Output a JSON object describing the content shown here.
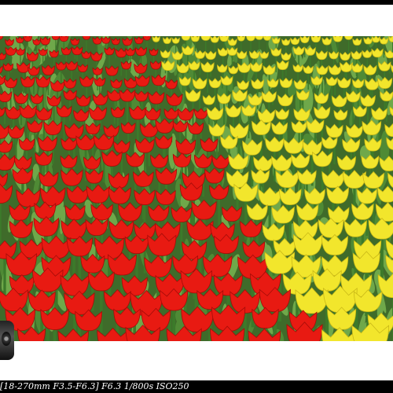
{
  "exif": {
    "text": "[18-270mm F3.5-F6.3] F6.3 1/800s ISO250"
  },
  "colors": {
    "red_tulip": "#e81a12",
    "yellow_tulip": "#f2e62c",
    "leaf_green": "#4f8a35"
  }
}
